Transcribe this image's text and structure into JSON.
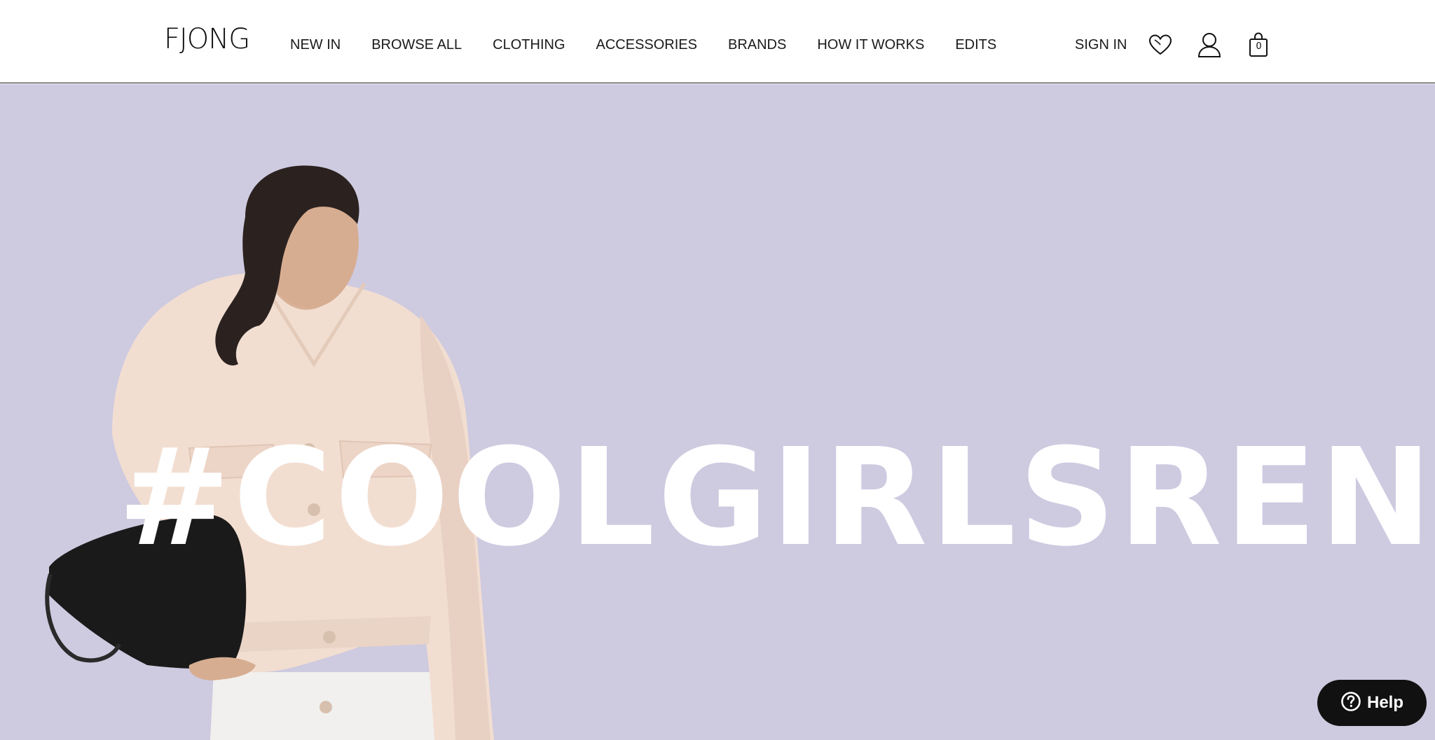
{
  "brand": {
    "logo_text": "FJONG"
  },
  "nav": {
    "items": [
      {
        "label": "NEW IN"
      },
      {
        "label": "BROWSE ALL"
      },
      {
        "label": "CLOTHING"
      },
      {
        "label": "ACCESSORIES"
      },
      {
        "label": "BRANDS"
      },
      {
        "label": "HOW IT WORKS"
      },
      {
        "label": "EDITS"
      }
    ]
  },
  "account": {
    "sign_in_label": "SIGN IN",
    "icons": [
      "heart-icon",
      "user-icon",
      "shopping-bag-icon"
    ],
    "cart_count": "0"
  },
  "hero": {
    "headline": "#COOLGIRLSRENT",
    "background_color": "#cecae0",
    "text_color": "#ffffff"
  },
  "help_widget": {
    "label": "Help",
    "icon": "question-circle-icon"
  }
}
